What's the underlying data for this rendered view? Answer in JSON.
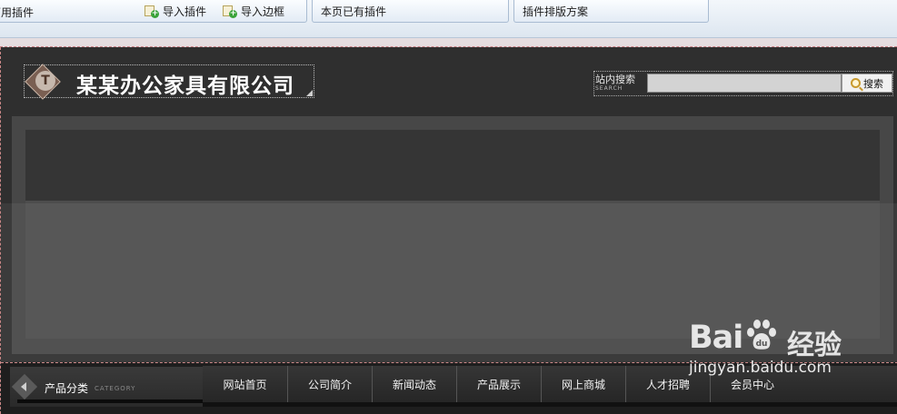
{
  "toolbar": {
    "group1_label": "可用插件",
    "import_plugin_label": "导入插件",
    "import_border_label": "导入边框",
    "group2_label": "本页已有插件",
    "group3_label": "插件排版方案"
  },
  "header": {
    "logo_letter": "T",
    "company_name": "某某办公家具有限公司",
    "search_title": "站内搜索",
    "search_sub": "SEARCH",
    "search_value": "",
    "search_button": "搜索"
  },
  "category": {
    "label": "产品分类",
    "sub": "CATEGORY"
  },
  "nav": {
    "items": [
      {
        "label": "网站首页"
      },
      {
        "label": "公司简介"
      },
      {
        "label": "新闻动态"
      },
      {
        "label": "产品展示"
      },
      {
        "label": "网上商城"
      },
      {
        "label": "人才招聘"
      },
      {
        "label": "会员中心"
      }
    ]
  },
  "watermark": {
    "brand": "Bai",
    "brand_tail": "du",
    "cn": "经验",
    "url": "jingyan.baidu.com"
  }
}
